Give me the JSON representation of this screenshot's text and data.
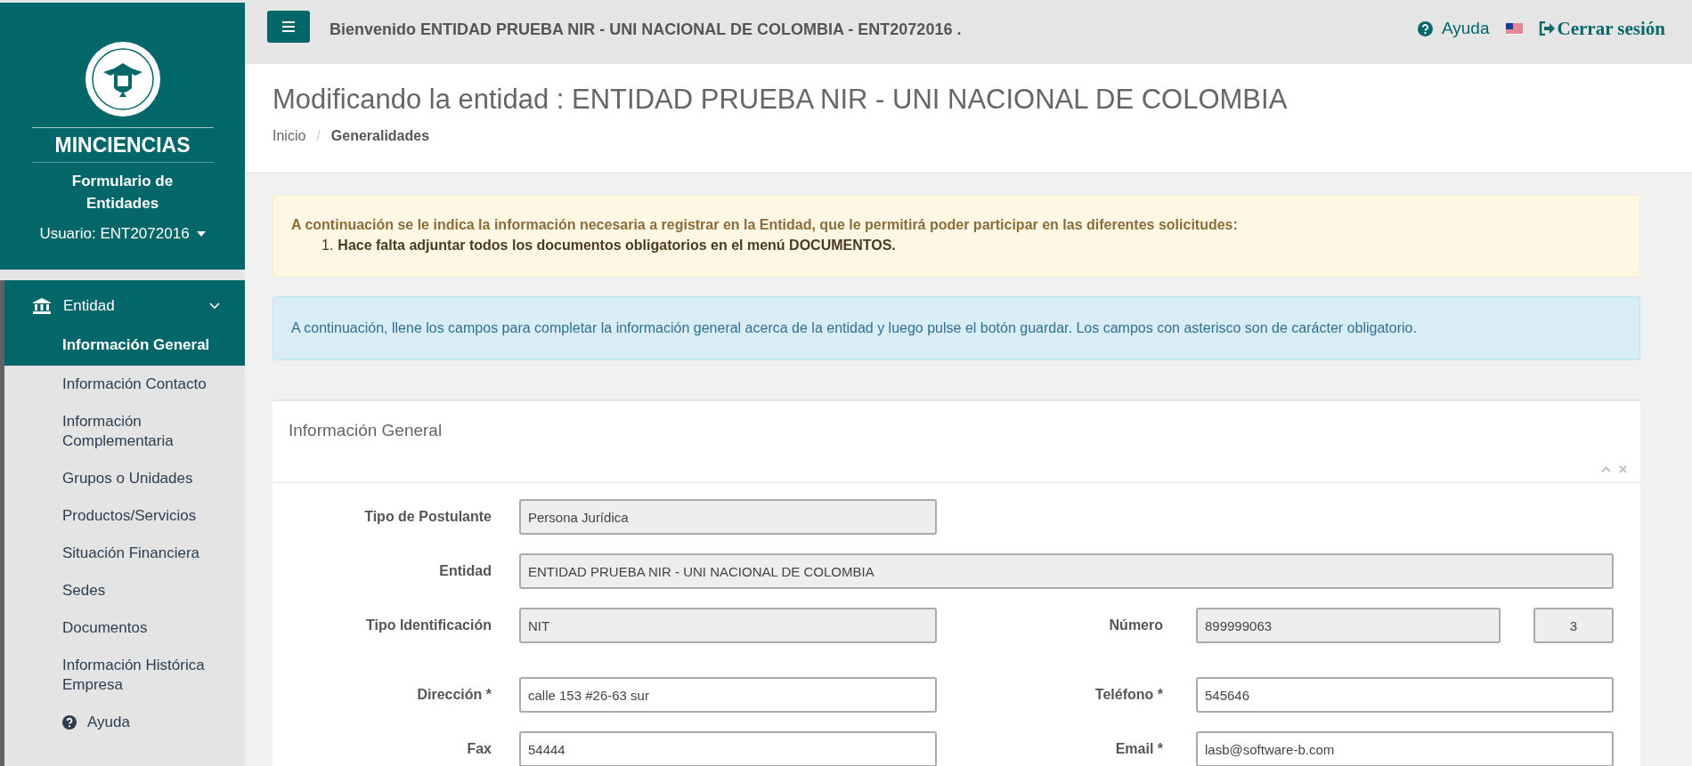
{
  "sidebar": {
    "brand": "MINCIENCIAS",
    "subtitle": "Formulario de Entidades",
    "user": "Usuario: ENT2072016",
    "menu": [
      {
        "label": "Entidad",
        "expanded": true,
        "children": [
          {
            "label": "Información General",
            "selected": true
          },
          {
            "label": "Información Contacto",
            "selected": false
          },
          {
            "label": "Información Complementaria",
            "selected": false
          },
          {
            "label": "Grupos o Unidades",
            "selected": false
          },
          {
            "label": "Productos/Servicios",
            "selected": false
          },
          {
            "label": "Situación Financiera",
            "selected": false
          },
          {
            "label": "Sedes",
            "selected": false
          },
          {
            "label": "Documentos",
            "selected": false
          },
          {
            "label": "Información Histórica Empresa",
            "selected": false
          }
        ]
      }
    ],
    "help": "Ayuda"
  },
  "topbar": {
    "welcome": "Bienvenido ENTIDAD PRUEBA NIR - UNI NACIONAL DE COLOMBIA - ENT2072016 .",
    "help": "Ayuda",
    "logout": "Cerrar sesión"
  },
  "page": {
    "title": "Modificando la entidad : ENTIDAD PRUEBA NIR - UNI NACIONAL DE COLOMBIA",
    "breadcrumb_separator": "/",
    "breadcrumb": [
      {
        "label": "Inicio",
        "selected": false
      },
      {
        "label": "Generalidades",
        "selected": true
      }
    ]
  },
  "alerts": [
    {
      "kind": "warning",
      "text": "A continuación se le indica la información necesaria a registrar en la Entidad, que le permitirá poder participar en las diferentes solicitudes:",
      "items": [
        {
          "marker": "1.",
          "text": "Hace falta adjuntar todos los documentos obligatorios en el menú DOCUMENTOS."
        }
      ]
    },
    {
      "kind": "info",
      "text": "A continuación, llene los campos para completar la información general acerca de la entidad y luego pulse el botón guardar. Los campos con asterisco son de carácter obligatorio."
    }
  ],
  "panel": {
    "title": "Información General",
    "rows": [
      {
        "fields": [
          {
            "label": "Tipo de Postulante",
            "values": [
              "Persona Jurídica"
            ],
            "disabled": true,
            "wide": false
          }
        ]
      },
      {
        "fields": [
          {
            "label": "Entidad",
            "values": [
              "ENTIDAD PRUEBA NIR - UNI NACIONAL DE COLOMBIA"
            ],
            "disabled": true,
            "wide": true
          }
        ]
      },
      {
        "fields": [
          {
            "label": "Tipo Identificación",
            "values": [
              "NIT"
            ],
            "disabled": true,
            "wide": false
          },
          {
            "label": "Número",
            "values": [
              "899999063",
              "3"
            ],
            "disabled": true,
            "wide": false
          }
        ]
      },
      {
        "fields": [
          {
            "label": "Dirección *",
            "values": [
              "calle 153 #26-63 sur"
            ],
            "disabled": false,
            "wide": false
          },
          {
            "label": "Teléfono *",
            "values": [
              "545646"
            ],
            "disabled": false,
            "wide": false
          }
        ]
      },
      {
        "fields": [
          {
            "label": "Fax",
            "values": [
              "54444"
            ],
            "disabled": false,
            "wide": false
          },
          {
            "label": "Email *",
            "values": [
              "lasb@software-b.com"
            ],
            "disabled": false,
            "wide": false
          }
        ]
      }
    ]
  }
}
